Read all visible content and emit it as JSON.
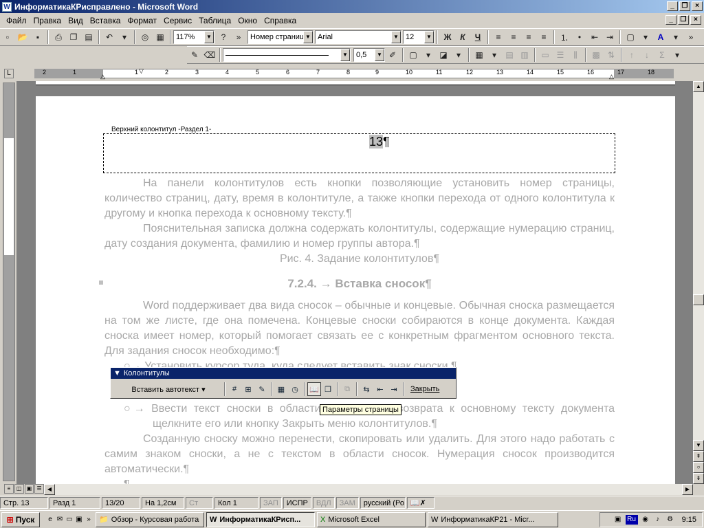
{
  "window": {
    "title": "ИнформатикаКРисправлено - Microsoft Word",
    "app_icon": "W",
    "minimize": "_",
    "maximize": "❐",
    "close": "×"
  },
  "menu": [
    "Файл",
    "Правка",
    "Вид",
    "Вставка",
    "Формат",
    "Сервис",
    "Таблица",
    "Окно",
    "Справка"
  ],
  "formatting": {
    "zoom": "117%",
    "style": "Номер страниц",
    "font": "Arial",
    "size": "12",
    "bold": "Ж",
    "italic": "К",
    "underline": "Ч",
    "line_width": "0,5"
  },
  "ruler": {
    "numbers": [
      "2",
      "1",
      "1",
      "2",
      "3",
      "4",
      "5",
      "6",
      "7",
      "8",
      "9",
      "10",
      "11",
      "12",
      "13",
      "14",
      "15",
      "16",
      "17",
      "18"
    ]
  },
  "document": {
    "header_label": "Верхний колонтитул -Раздел 1-",
    "page_number": "13",
    "pilcrow": "¶",
    "paragraphs": [
      "На панели колонтитулов есть кнопки позволяющие установить номер страницы, количество страниц, дату, время в колонтитуле, а также кнопки перехода от одного колонтитула к другому и кнопка перехода к основному тексту.¶",
      "Пояснительная записка должна содержать колонтитулы, содержащие нумерацию страниц, дату создания документа, фамилию и номер группы автора.¶"
    ],
    "caption": "Рис. 4. Задание колонтитулов¶",
    "heading": "7.2.4. → Вставка сносок¶",
    "para3": "Word поддерживает два вида сносок – обычные и концевые. Обычная сноска размещается на том же листе, где она помечена. Концевые сноски собираются в конце документа. Каждая сноска имеет номер, который помогает связать ее с конкретным фрагментом основного текста. Для задания сносок необходимо:¶",
    "bullet1": "○→ Установить курсор туда, куда следует вставить знак сноски.¶",
    "bullet2": "○→ Ввести текст сноски в области сносок. Для возврата к основному тексту документа щелкните его или кнопку Закрыть меню колонтитулов.¶",
    "para4": "Созданную сноску можно перенести, скопировать или удалить. Для этого надо работать с самим знаком сноски, а не с текстом в области сносок. Нумерация сносок производится автоматически.¶",
    "last": "¶"
  },
  "hf_toolbar": {
    "title": "Колонтитулы",
    "insert_autotext": "Вставить автотекст ▾",
    "close": "Закрыть"
  },
  "tooltip": "Параметры страницы",
  "status": {
    "page": "Стр. 13",
    "section": "Разд 1",
    "pages": "13/20",
    "at": "На 1,2см",
    "line": "Ст",
    "col": "Кол 1",
    "rec": "ЗАП",
    "trk": "ИСПР",
    "ext": "ВДЛ",
    "ovr": "ЗАМ",
    "lang": "русский (Ро"
  },
  "taskbar": {
    "start": "Пуск",
    "tasks": [
      "Обзор - Курсовая работа",
      "ИнформатикаКРисп...",
      "Microsoft Excel",
      "ИнформатикаКР21 - Micr..."
    ],
    "clock": "9:15",
    "lang_indicator": "Ru"
  }
}
